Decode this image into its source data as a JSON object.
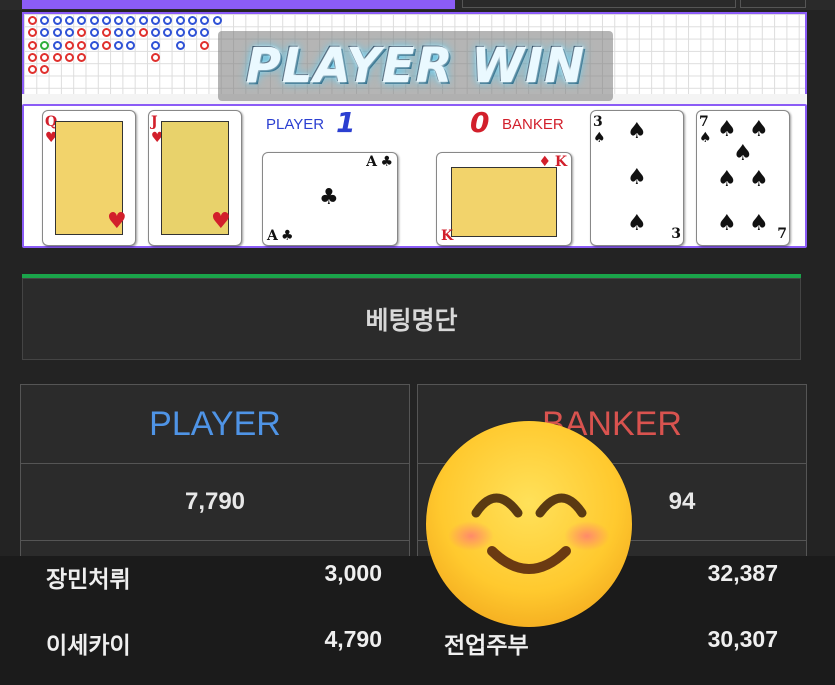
{
  "banner": {
    "text": "PLAYER WIN"
  },
  "player": {
    "label": "PLAYER",
    "score": "1"
  },
  "banker": {
    "label": "BANKER",
    "score": "0"
  },
  "cards": {
    "player": [
      {
        "rank": "Q",
        "suit": "♥",
        "color": "#d21f2b"
      },
      {
        "rank": "J",
        "suit": "♥",
        "color": "#d21f2b"
      },
      {
        "rank": "A",
        "suit": "♣",
        "color": "#111111"
      }
    ],
    "banker": [
      {
        "rank": "K",
        "suit": "♦",
        "color": "#d21f2b"
      },
      {
        "rank": "3",
        "suit": "♠",
        "color": "#111111"
      },
      {
        "rank": "7",
        "suit": "♠",
        "color": "#111111"
      }
    ]
  },
  "betlist": {
    "title": "베팅명단"
  },
  "panels": {
    "player": {
      "title": "PLAYER",
      "color": "#4f94e6",
      "total": "7,790"
    },
    "banker": {
      "title": "BANKER",
      "color": "#d9534f",
      "total": "94"
    }
  },
  "bets": {
    "player": [
      {
        "name": "장민처뤼",
        "amount": "3,000"
      },
      {
        "name": "이세카이",
        "amount": "4,790"
      }
    ],
    "banker": [
      {
        "name": ")",
        "amount": "32,387"
      },
      {
        "name": "전업주부",
        "amount": "30,307"
      }
    ]
  },
  "colors": {
    "accent": "#8b5cf6",
    "success": "#1aa34a"
  },
  "overlay": {
    "icon": "smiling-face-emoji"
  }
}
